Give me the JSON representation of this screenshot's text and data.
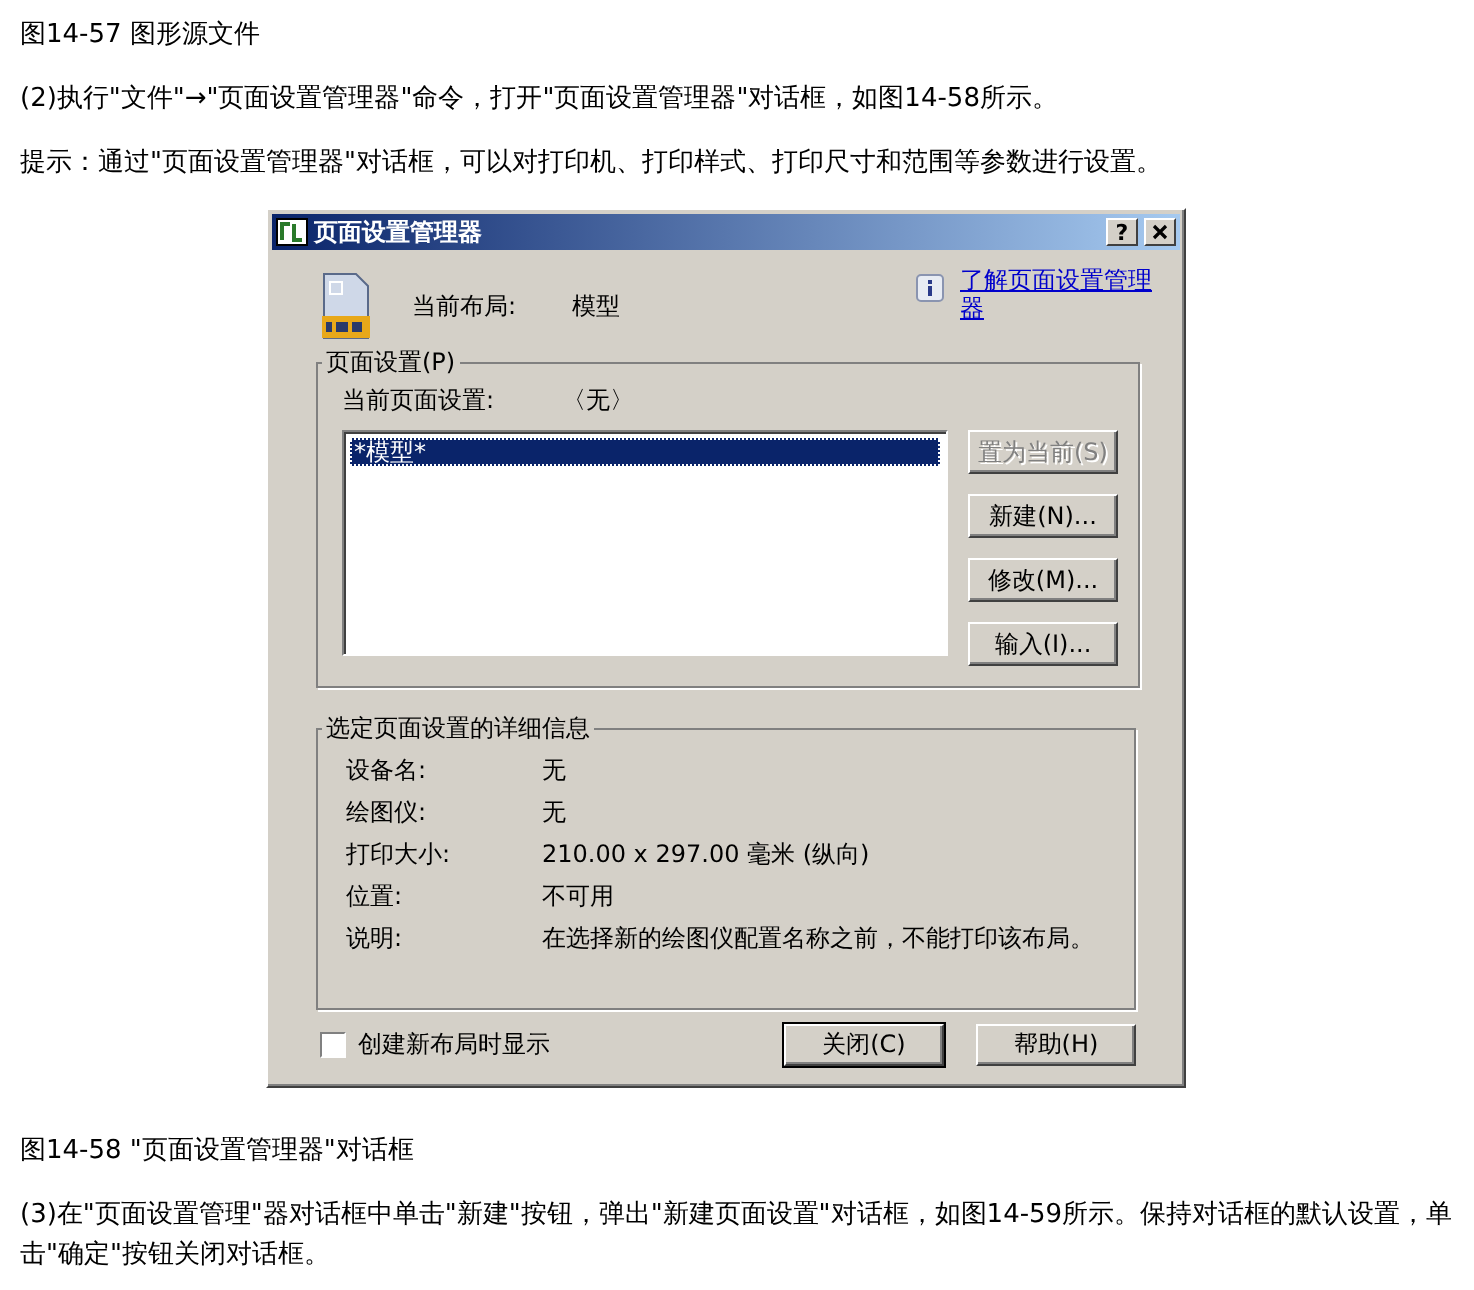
{
  "article_top": {
    "caption": "图14-57 图形源文件",
    "paragraphs": [
      "(2)执行\"文件\"→\"页面设置管理器\"命令，打开\"页面设置管理器\"对话框，如图14-58所示。",
      "提示：通过\"页面设置管理器\"对话框，可以对打印机、打印样式、打印尺寸和范围等参数进行设置。"
    ]
  },
  "dialog": {
    "title": "页面设置管理器",
    "help_button": "?",
    "current_layout_label": "当前布局:",
    "current_layout_value": "模型",
    "help_link": "了解页面设置管理器",
    "page_setups": {
      "group_title": "页面设置(P)",
      "current_label": "当前页面设置:",
      "current_value": "〈无〉",
      "items": [
        {
          "text": "*模型*",
          "selected": true
        }
      ],
      "buttons": [
        {
          "label": "置为当前(S)",
          "disabled": true
        },
        {
          "label": "新建(N)...",
          "disabled": false
        },
        {
          "label": "修改(M)...",
          "disabled": false
        },
        {
          "label": "输入(I)...",
          "disabled": false
        }
      ]
    },
    "details": {
      "group_title": "选定页面设置的详细信息",
      "rows": [
        {
          "label": "设备名:",
          "value": "无"
        },
        {
          "label": "绘图仪:",
          "value": "无"
        },
        {
          "label": "打印大小:",
          "value": "210.00 x 297.00 毫米 (纵向)"
        },
        {
          "label": "位置:",
          "value": "不可用"
        },
        {
          "label": "说明:",
          "value": "在选择新的绘图仪配置名称之前，不能打印该布局。"
        }
      ]
    },
    "show_on_new_layout": {
      "label": "创建新布局时显示",
      "checked": false
    },
    "footer_buttons": [
      {
        "label": "关闭(C)",
        "default": true
      },
      {
        "label": "帮助(H)",
        "default": false
      }
    ]
  },
  "article_bottom": {
    "caption": "图14-58 \"页面设置管理器\"对话框",
    "paragraphs": [
      "(3)在\"页面设置管理\"器对话框中单击\"新建\"按钮，弹出\"新建页面设置\"对话框，如图14-59所示。保持对话框的默认设置，单击\"确定\"按钮关闭对话框。"
    ]
  }
}
